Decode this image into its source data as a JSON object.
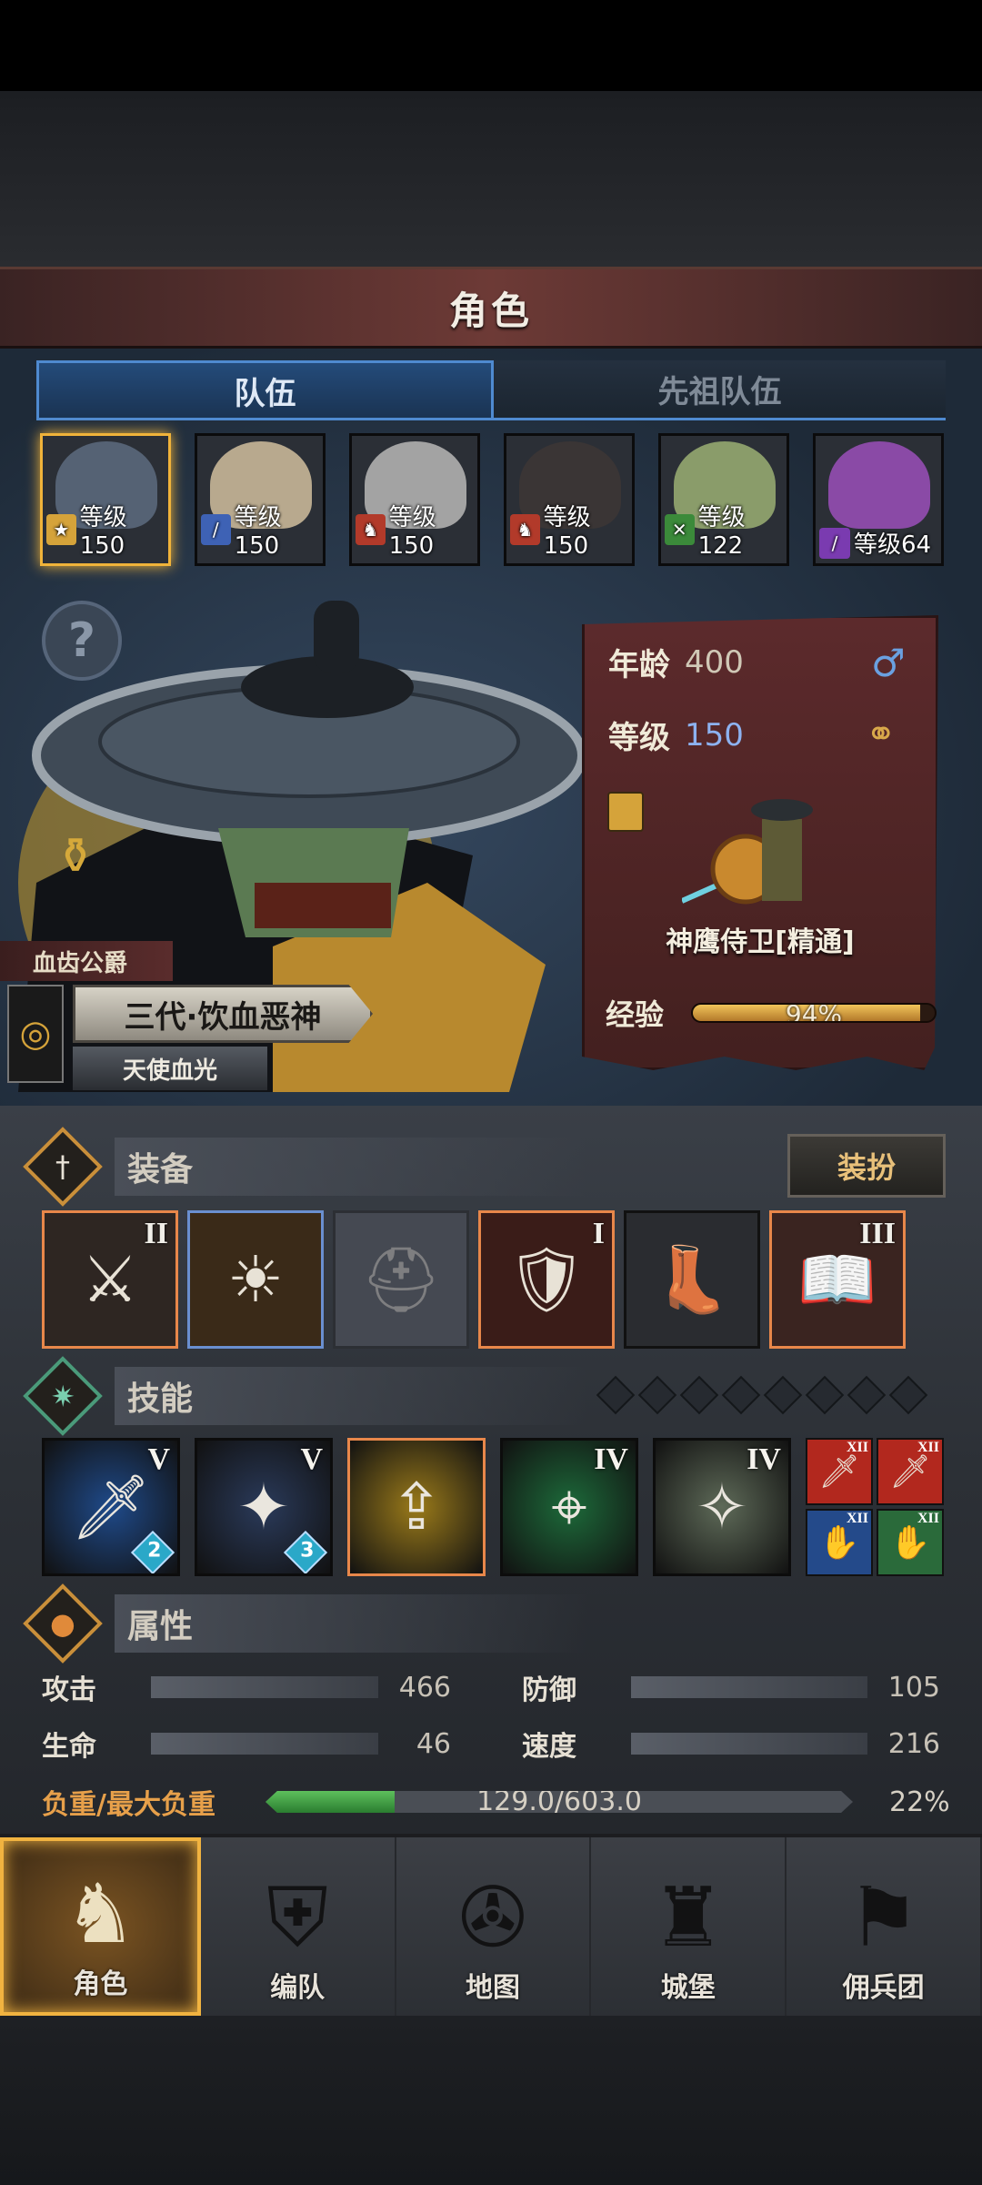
{
  "header": {
    "title": "角色"
  },
  "tabs": [
    {
      "label": "队伍",
      "active": true
    },
    {
      "label": "先祖队伍",
      "active": false
    }
  ],
  "roster": [
    {
      "level_label": "等级150",
      "class_icon": "shield-star-icon",
      "class_color": "#d5a33a",
      "selected": true,
      "face_color": "#556274"
    },
    {
      "level_label": "等级150",
      "class_icon": "sword-icon",
      "class_color": "#3e62b5",
      "selected": false,
      "face_color": "#b8a98e"
    },
    {
      "level_label": "等级150",
      "class_icon": "horse-icon",
      "class_color": "#b23a2a",
      "selected": false,
      "face_color": "#a3a3a3"
    },
    {
      "level_label": "等级150",
      "class_icon": "horse-icon",
      "class_color": "#b23a2a",
      "selected": false,
      "face_color": "#3a3535"
    },
    {
      "level_label": "等级122",
      "class_icon": "crossed-swords-icon",
      "class_color": "#3b8a3a",
      "selected": false,
      "face_color": "#8a9c6a"
    },
    {
      "level_label": "等级64",
      "class_icon": "staff-icon",
      "class_color": "#7a3bb0",
      "selected": false,
      "face_color": "#8a4aa6"
    }
  ],
  "character": {
    "class_tag": "血齿公爵",
    "name": "三代·饮血恶神",
    "subtitle": "天使血光"
  },
  "stat_card": {
    "age_label": "年龄",
    "age_value": "400",
    "level_label": "等级",
    "level_value": "150",
    "gender_icon": "♂",
    "class_name": "神鹰侍卫[精通]",
    "exp_label": "经验",
    "exp_percent_text": "94%",
    "exp_fraction": 0.94
  },
  "equipment": {
    "title": "装备",
    "dress_button": "装扮",
    "slots": [
      {
        "name": "weapon-slot",
        "tier": "II",
        "rarity": "orange",
        "glyph": "⚔",
        "bg": "#2e2622"
      },
      {
        "name": "shield-slot",
        "tier": "",
        "rarity": "blue",
        "glyph": "☀",
        "bg": "#3a2a18"
      },
      {
        "name": "helmet-slot-empty",
        "tier": "",
        "rarity": "empty",
        "glyph": "⛑",
        "bg": "#454952"
      },
      {
        "name": "armor-slot",
        "tier": "I",
        "rarity": "orange",
        "glyph": "🛡",
        "bg": "#3a1c18"
      },
      {
        "name": "boots-slot",
        "tier": "",
        "rarity": "none",
        "glyph": "👢",
        "bg": "#2a2c30"
      },
      {
        "name": "book-slot",
        "tier": "III",
        "rarity": "orange",
        "glyph": "📖",
        "bg": "#3a2420"
      }
    ]
  },
  "skills": {
    "title": "技能",
    "slot_count": 8,
    "items": [
      {
        "tier": "V",
        "bg": "#1f4a8a",
        "glyph": "🗡",
        "sub": "2",
        "border": "#0c0c0c"
      },
      {
        "tier": "V",
        "bg": "#2a3a5a",
        "glyph": "✦",
        "sub": "3",
        "border": "#0c0c0c"
      },
      {
        "tier": "",
        "bg": "#9a7a1a",
        "glyph": "⇪",
        "sub": "",
        "border": "#e8874a"
      },
      {
        "tier": "IV",
        "bg": "#1d6a3a",
        "glyph": "⌖",
        "sub": "",
        "border": "#0c0c0c"
      },
      {
        "tier": "IV",
        "bg": "#5e6a58",
        "glyph": "✧",
        "sub": "",
        "border": "#0c0c0c"
      }
    ],
    "mini": [
      {
        "tier": "XII",
        "bg": "#b2281e",
        "glyph": "🗡"
      },
      {
        "tier": "XII",
        "bg": "#b2281e",
        "glyph": "🗡"
      },
      {
        "tier": "XII",
        "bg": "#244a8a",
        "glyph": "✋"
      },
      {
        "tier": "XII",
        "bg": "#2a6a3a",
        "glyph": "✋"
      }
    ]
  },
  "attributes": {
    "title": "属性",
    "attack_label": "攻击",
    "attack_value": "466",
    "defense_label": "防御",
    "defense_value": "105",
    "life_label": "生命",
    "life_value": "46",
    "speed_label": "速度",
    "speed_value": "216",
    "load_label": "负重/最大负重",
    "load_text": "129.0/603.0",
    "load_percent": "22%",
    "load_fraction": 0.22
  },
  "nav": [
    {
      "label": "角色",
      "icon": "character-icon",
      "glyph": "♞",
      "active": true
    },
    {
      "label": "编队",
      "icon": "formation-icon",
      "glyph": "⛨",
      "active": false
    },
    {
      "label": "地图",
      "icon": "compass-map-icon",
      "glyph": "✇",
      "active": false
    },
    {
      "label": "城堡",
      "icon": "castle-icon",
      "glyph": "♜",
      "active": false
    },
    {
      "label": "佣兵团",
      "icon": "mercenary-icon",
      "glyph": "⚑",
      "active": false
    }
  ]
}
